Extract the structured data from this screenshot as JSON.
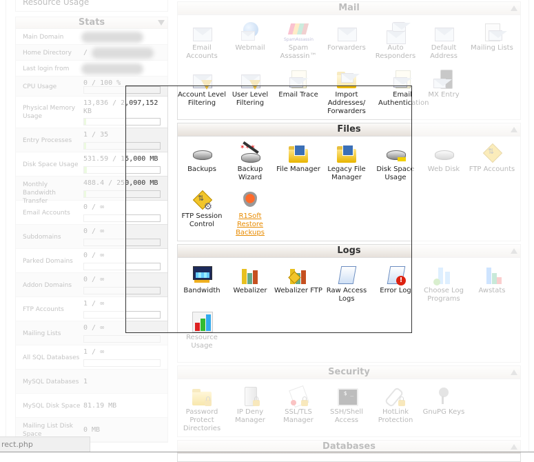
{
  "left": {
    "resource_usage_label": "Resource Usage",
    "stats": {
      "title": "Stats",
      "rows": [
        {
          "label": "Main Domain",
          "value": "",
          "redacted": true
        },
        {
          "label": "Home Directory",
          "value": "/",
          "redacted": true
        },
        {
          "label": "Last login from",
          "value": "",
          "redacted": true
        },
        {
          "label": "CPU Usage",
          "value": "0 / 100 %",
          "bar": 0
        },
        {
          "label": "Physical Memory Usage",
          "value": "13,836 / 2,097,152 KB",
          "bar": 0.007
        },
        {
          "label": "Entry Processes",
          "value": "1 / 35",
          "bar": 0.029
        },
        {
          "label": "Disk Space Usage",
          "value": "531.59 / 15,000 MB",
          "bar": 0.035
        },
        {
          "label": "Monthly Bandwidth Transfer",
          "value": "488.4 / 250,000 MB",
          "bar": 0.002
        },
        {
          "label": "Email Accounts",
          "value": "0 / ∞",
          "bar": 0
        },
        {
          "label": "Subdomains",
          "value": "0 / ∞",
          "bar": 0
        },
        {
          "label": "Parked Domains",
          "value": "0 / ∞",
          "bar": 0
        },
        {
          "label": "Addon Domains",
          "value": "0 / ∞",
          "bar": 0
        },
        {
          "label": "FTP Accounts",
          "value": "1 / ∞",
          "bar": 0
        },
        {
          "label": "Mailing Lists",
          "value": "0 / ∞",
          "bar": 0
        },
        {
          "label": "All SQL Databases",
          "value": "1 / ∞",
          "bar": 0
        },
        {
          "label": "MySQL Databases",
          "value": "1"
        },
        {
          "label": "MySQL Disk Space",
          "value": "81.19 MB"
        },
        {
          "label": "Mailing List Disk Space",
          "value": "0 MB"
        }
      ]
    }
  },
  "panels": {
    "mail": {
      "title": "Mail",
      "items": [
        {
          "label": "Email Accounts",
          "icon": "email-accounts-icon"
        },
        {
          "label": "Webmail",
          "icon": "webmail-icon"
        },
        {
          "label": "Spam Assassin™",
          "icon": "spamassassin-icon",
          "icon_text": "SpamAssassin"
        },
        {
          "label": "Forwarders",
          "icon": "forwarders-icon"
        },
        {
          "label": "Auto Responders",
          "icon": "auto-responders-icon"
        },
        {
          "label": "Default Address",
          "icon": "default-address-icon"
        },
        {
          "label": "Mailing Lists",
          "icon": "mailing-lists-icon"
        },
        {
          "label": "Account Level Filtering",
          "icon": "account-filtering-icon"
        },
        {
          "label": "User Level Filtering",
          "icon": "user-filtering-icon"
        },
        {
          "label": "Email Trace",
          "icon": "email-trace-icon"
        },
        {
          "label": "Import Addresses/ Forwarders",
          "icon": "import-icon"
        },
        {
          "label": "Email Authentication",
          "icon": "email-auth-icon"
        },
        {
          "label": "MX Entry",
          "icon": "mx-entry-icon"
        }
      ]
    },
    "files": {
      "title": "Files",
      "items": [
        {
          "label": "Backups",
          "icon": "backups-icon"
        },
        {
          "label": "Backup Wizard",
          "icon": "backup-wizard-icon"
        },
        {
          "label": "File Manager",
          "icon": "file-manager-icon"
        },
        {
          "label": "Legacy File Manager",
          "icon": "legacy-file-manager-icon"
        },
        {
          "label": "Disk Space Usage",
          "icon": "disk-usage-icon"
        },
        {
          "label": "Web Disk",
          "icon": "web-disk-icon"
        },
        {
          "label": "FTP Accounts",
          "icon": "ftp-accounts-icon"
        },
        {
          "label": "FTP Session Control",
          "icon": "ftp-session-icon"
        },
        {
          "label": "R1Soft Restore Backups",
          "icon": "r1soft-icon",
          "link": true
        }
      ]
    },
    "logs": {
      "title": "Logs",
      "items": [
        {
          "label": "Bandwidth",
          "icon": "bandwidth-icon"
        },
        {
          "label": "Webalizer",
          "icon": "webalizer-icon"
        },
        {
          "label": "Webalizer FTP",
          "icon": "webalizer-ftp-icon"
        },
        {
          "label": "Raw Access Logs",
          "icon": "raw-logs-icon"
        },
        {
          "label": "Error Log",
          "icon": "error-log-icon"
        },
        {
          "label": "Choose Log Programs",
          "icon": "choose-log-icon"
        },
        {
          "label": "Awstats",
          "icon": "awstats-icon"
        },
        {
          "label": "Resource Usage",
          "icon": "resource-usage-icon"
        }
      ]
    },
    "security": {
      "title": "Security",
      "items": [
        {
          "label": "Password Protect Directories",
          "icon": "password-protect-icon"
        },
        {
          "label": "IP Deny Manager",
          "icon": "ip-deny-icon"
        },
        {
          "label": "SSL/TLS Manager",
          "icon": "ssl-icon"
        },
        {
          "label": "SSH/Shell Access",
          "icon": "ssh-icon",
          "icon_text": "$ _"
        },
        {
          "label": "HotLink Protection",
          "icon": "hotlink-icon"
        },
        {
          "label": "GnuPG Keys",
          "icon": "gnupg-icon"
        }
      ]
    },
    "databases": {
      "title": "Databases"
    }
  },
  "status_bar": {
    "text": "rect.php"
  }
}
